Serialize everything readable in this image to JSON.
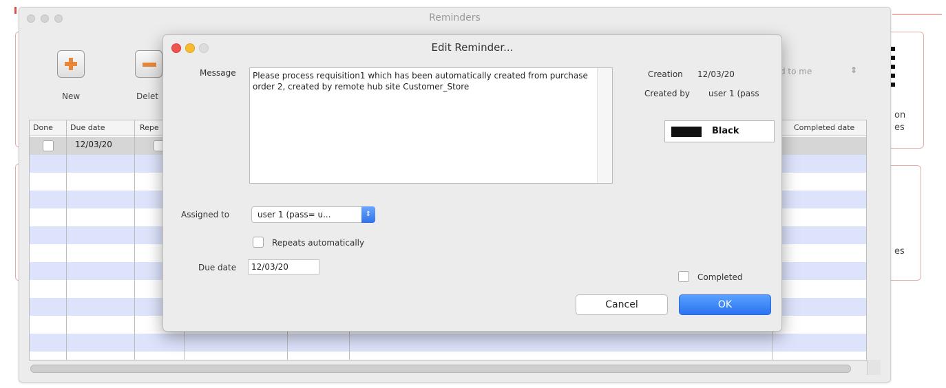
{
  "background": {
    "right_cards": [
      {
        "text_a": "on",
        "text_b": "es"
      },
      {
        "text_a": "es"
      }
    ],
    "reminders_window": {
      "title": "Reminders",
      "toolbar": {
        "new_label": "New",
        "delete_label": "Delet"
      },
      "filter_label": "d to me",
      "table": {
        "columns": [
          "Done",
          "Due date",
          "Repe",
          "Completed date"
        ],
        "rows": [
          {
            "due_date": "12/03/20"
          }
        ]
      }
    }
  },
  "dialog": {
    "title": "Edit Reminder...",
    "message_label": "Message",
    "message_text": "Please process requisition1 which has been automatically created from purchase order 2, created by remote hub site Customer_Store",
    "creation_label": "Creation",
    "creation_value": "12/03/20",
    "created_by_label": "Created by",
    "created_by_value": "user 1 (pass",
    "color_name": "Black",
    "color_hex": "#111111",
    "assigned_to_label": "Assigned to",
    "assigned_to_value": "user 1 (pass= u...",
    "repeats_label": "Repeats automatically",
    "due_date_label": "Due date",
    "due_date_value": "12/03/20",
    "completed_label": "Completed",
    "cancel_label": "Cancel",
    "ok_label": "OK"
  },
  "colors": {
    "accent": "#2a74f0",
    "row_stripe": "#dde3fb",
    "card_border": "#e3aca6"
  }
}
